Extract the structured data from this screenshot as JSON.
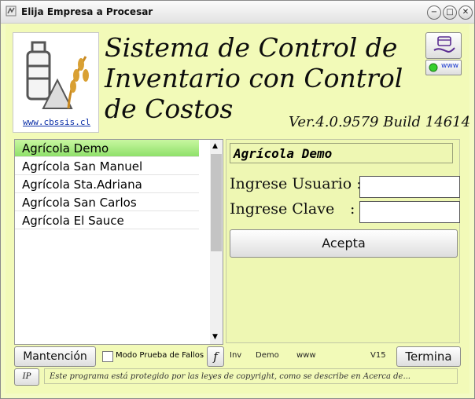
{
  "window": {
    "title": "Elija Empresa a Procesar",
    "minimize": "−",
    "maximize": "□",
    "close": "✕"
  },
  "header": {
    "logo_url": "www.cbssis.cl",
    "title": "Sistema de Control de Inventario con Control  de Costos",
    "version": "Ver.4.0.9579 Build 14614",
    "www_label": "www"
  },
  "companies": [
    "Agrícola Demo",
    "Agrícola San Manuel",
    "Agrícola Sta.Adriana",
    "Agrícola San Carlos",
    "Agrícola El Sauce"
  ],
  "selected_company": "Agrícola Demo",
  "login": {
    "company": "Agrícola Demo",
    "user_label": "Ingrese Usuario :",
    "password_label": "Ingrese Clave",
    "colon": ":",
    "user_value": "",
    "password_value": "",
    "accept": "Acepta"
  },
  "toolbar": {
    "maintenance": "Mantención",
    "fault_mode": "Modo Prueba de Fallos",
    "f_button": "f",
    "terminate": "Termina",
    "ip": "IP"
  },
  "status": {
    "inv": "Inv",
    "db": "Demo",
    "www": "www",
    "version": "V15"
  },
  "footer": {
    "copyright": "Este programa está protegido por las leyes de copyright, como se describe en Acerca de..."
  },
  "colors": {
    "background": "#f2fab8",
    "selection": "#9be47a",
    "link": "#0b2fa8"
  }
}
